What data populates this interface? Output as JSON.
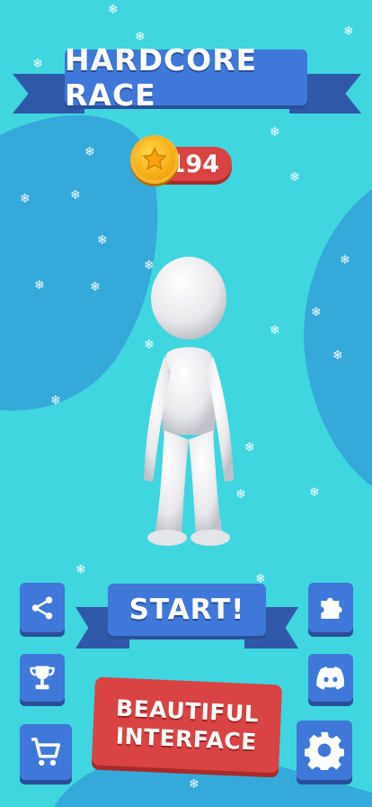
{
  "game": {
    "title": "HARDCORE RACE",
    "coins": "194",
    "start_label": "START!",
    "feature_line1": "BEAUTIFUL",
    "feature_line2": "INTERFACE"
  },
  "buttons": {
    "left": [
      {
        "icon": "share-icon"
      },
      {
        "icon": "trophy-icon"
      },
      {
        "icon": "cart-icon"
      }
    ],
    "right": [
      {
        "icon": "puzzle-icon"
      },
      {
        "icon": "discord-icon"
      },
      {
        "icon": "gear-icon"
      }
    ]
  },
  "colors": {
    "background": "#3fd6e0",
    "blob": "#35a9d9",
    "ribbon_blue": "#3f78d8",
    "ribbon_dark": "#2f58a8",
    "banner_red": "#d94343",
    "coin_gold": "#f5a611"
  }
}
